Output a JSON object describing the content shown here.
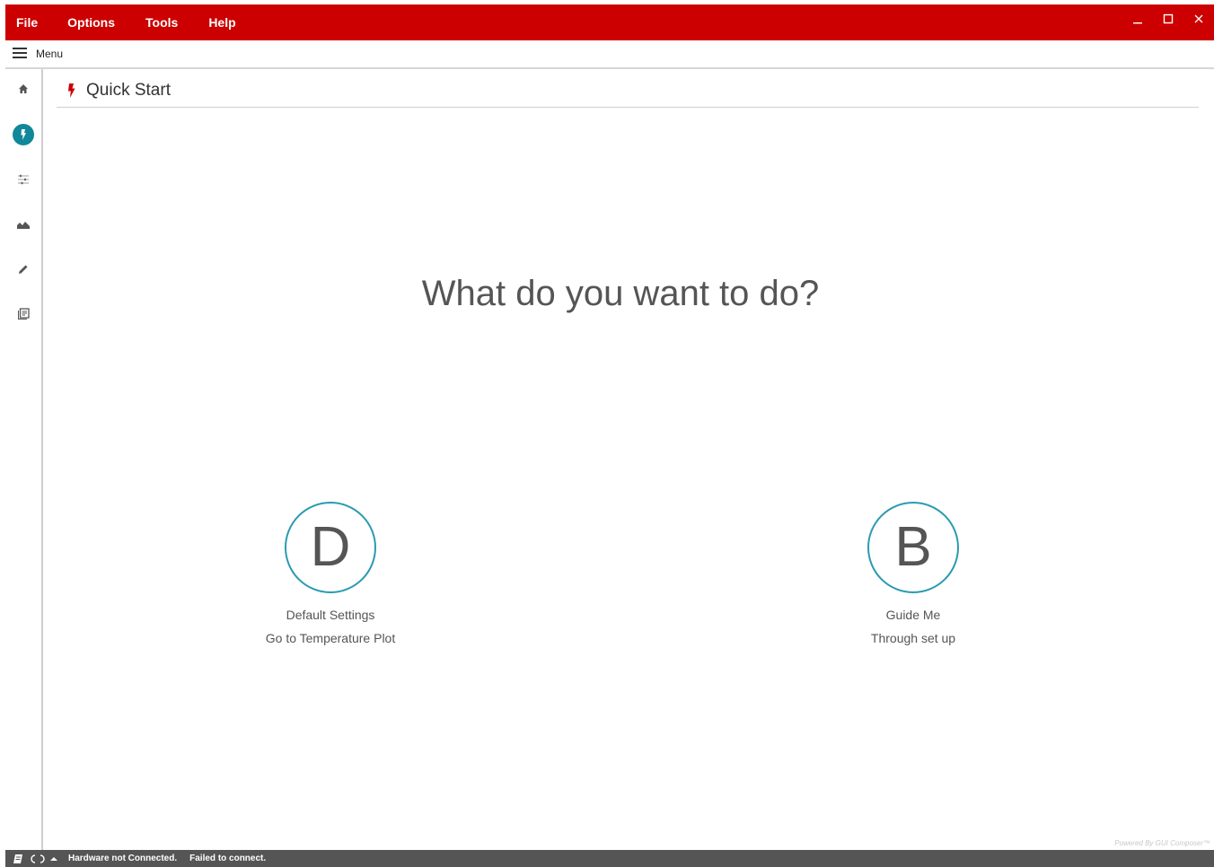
{
  "menubar": {
    "items": [
      "File",
      "Options",
      "Tools",
      "Help"
    ],
    "window_controls": [
      "minimize-icon",
      "maximize-icon",
      "close-icon"
    ]
  },
  "menu_toggle": {
    "label": "Menu",
    "icon": "hamburger-icon"
  },
  "sidebar": {
    "items": [
      {
        "icon": "home-icon",
        "active": false
      },
      {
        "icon": "lightning-icon",
        "active": true
      },
      {
        "icon": "sliders-icon",
        "active": false
      },
      {
        "icon": "area-chart-icon",
        "active": false
      },
      {
        "icon": "pencil-icon",
        "active": false
      },
      {
        "icon": "library-books-icon",
        "active": false
      }
    ]
  },
  "page": {
    "title": "Quick Start",
    "title_icon": "lightning-icon",
    "question": "What do you want to do?"
  },
  "options": [
    {
      "letter": "D",
      "line1": "Default Settings",
      "line2": "Go to Temperature Plot"
    },
    {
      "letter": "B",
      "line1": "Guide Me",
      "line2": "Through set up"
    }
  ],
  "footer": {
    "powered_by": "Powered By GUI Composer™",
    "status_main": "Hardware not Connected.",
    "status_detail": "Failed to connect."
  },
  "colors": {
    "brand_red": "#cc0000",
    "accent_teal": "#2a9bb0",
    "status_gray": "#555555"
  }
}
